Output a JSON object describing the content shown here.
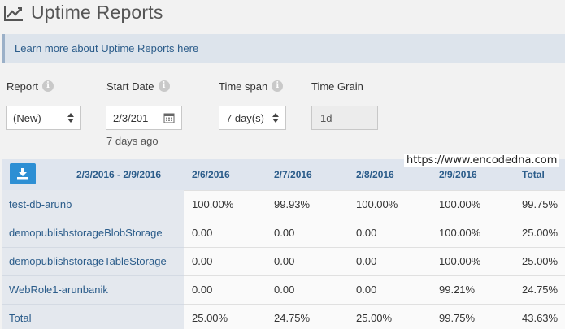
{
  "header": {
    "title": "Uptime Reports",
    "icon": "line-chart-icon"
  },
  "info_bar": {
    "link_text": "Learn more about Uptime Reports here"
  },
  "filters": {
    "report": {
      "label": "Report",
      "value": "(New)"
    },
    "start_date": {
      "label": "Start Date",
      "value": "2/3/201",
      "hint": "7 days ago"
    },
    "time_span": {
      "label": "Time span",
      "value": "7 day(s)"
    },
    "time_grain": {
      "label": "Time Grain",
      "value": "1d"
    }
  },
  "table": {
    "range_label": "2/3/2016 - 2/9/2016",
    "columns": [
      "2/6/2016",
      "2/7/2016",
      "2/8/2016",
      "2/9/2016",
      "Total"
    ],
    "rows": [
      {
        "name": "test-db-arunb",
        "values": [
          "100.00%",
          "99.93%",
          "100.00%",
          "100.00%",
          "99.75%"
        ]
      },
      {
        "name": "demopublishstorageBlobStorage",
        "values": [
          "0.00",
          "0.00",
          "0.00",
          "100.00%",
          "25.00%"
        ]
      },
      {
        "name": "demopublishstorageTableStorage",
        "values": [
          "0.00",
          "0.00",
          "0.00",
          "100.00%",
          "25.00%"
        ]
      },
      {
        "name": "WebRole1-arunbanik",
        "values": [
          "0.00",
          "0.00",
          "0.00",
          "99.21%",
          "24.75%"
        ]
      },
      {
        "name": "Total",
        "values": [
          "25.00%",
          "24.75%",
          "25.00%",
          "99.75%",
          "43.63%"
        ]
      }
    ]
  },
  "watermark": "https://www.encodedna.com",
  "colors": {
    "accent": "#2d8fd4",
    "link": "#2b5c8a",
    "info_bar": "#dde4ec"
  }
}
